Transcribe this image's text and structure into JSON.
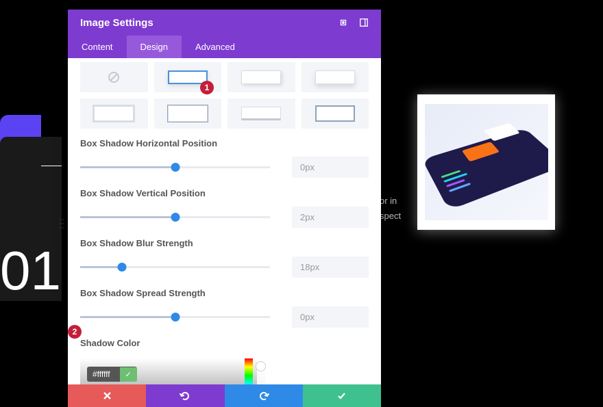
{
  "background": {
    "number": "01",
    "text_line1": "or in",
    "text_line2": "spect"
  },
  "panel": {
    "title": "Image Settings",
    "tabs": [
      "Content",
      "Design",
      "Advanced"
    ],
    "active_tab": 1
  },
  "presets": {
    "selected_index": 1
  },
  "sliders": [
    {
      "label": "Box Shadow Horizontal Position",
      "value": "0px",
      "percent": 50
    },
    {
      "label": "Box Shadow Vertical Position",
      "value": "2px",
      "percent": 50
    },
    {
      "label": "Box Shadow Blur Strength",
      "value": "18px",
      "percent": 22
    },
    {
      "label": "Box Shadow Spread Strength",
      "value": "0px",
      "percent": 50
    }
  ],
  "shadow_color": {
    "label": "Shadow Color",
    "hex": "#ffffff"
  },
  "annotations": {
    "a1": "1",
    "a2": "2"
  }
}
